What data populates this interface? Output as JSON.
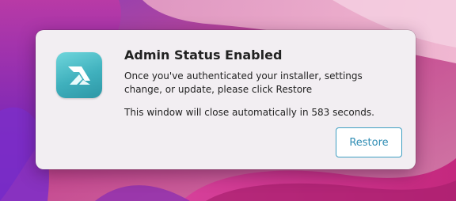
{
  "dialog": {
    "title": "Admin Status Enabled",
    "message": "Once you've authenticated your installer, settings change, or update, please click Restore",
    "countdown": "This window will close automatically in 583 seconds.",
    "restore_label": "Restore",
    "app_icon": "privileges-app-icon"
  },
  "colors": {
    "accent": "#3f9fc2",
    "icon_tint": "#4bbcc6",
    "dialog_background": "#f2eef2"
  }
}
